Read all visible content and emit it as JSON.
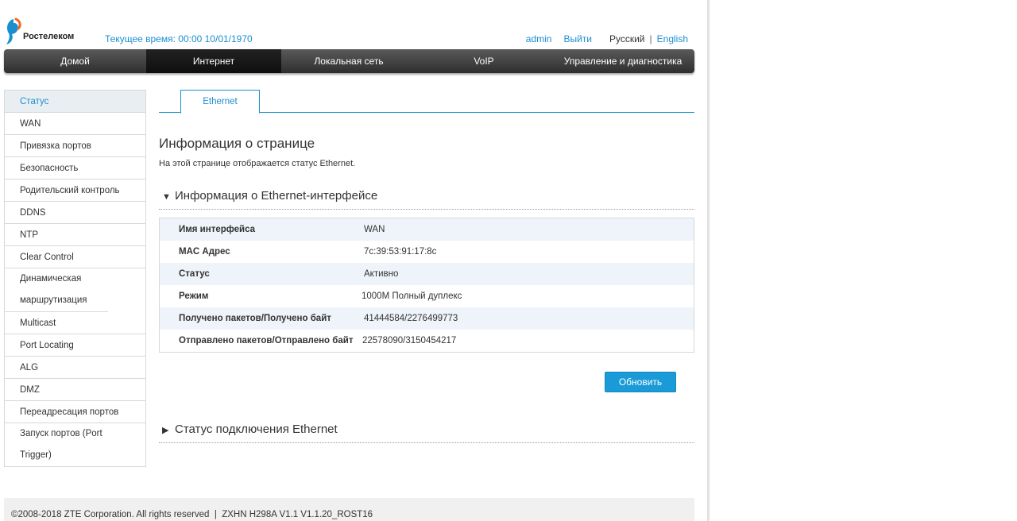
{
  "header": {
    "logo_text": "Ростелеком",
    "current_time": "Текущее время: 00:00 10/01/1970",
    "user": "admin",
    "logout": "Выйти",
    "lang_current": "Русский",
    "lang_sep": "|",
    "lang_other": "English"
  },
  "nav": {
    "items": [
      "Домой",
      "Интернет",
      "Локальная сеть",
      "VoIP",
      "Управление и диагностика"
    ],
    "active_index": 1
  },
  "sidebar": {
    "items": [
      "Статус",
      "WAN",
      "Привязка портов",
      "Безопасность",
      "Родительский контроль",
      "DDNS",
      "NTP",
      "Clear Control",
      "Динамическая маршрутизация",
      "Multicast",
      "Port Locating",
      "ALG",
      "DMZ",
      "Переадресация портов",
      "Запуск портов (Port Trigger)"
    ],
    "active_index": 0
  },
  "tabs": {
    "active": "Ethernet"
  },
  "page": {
    "title": "Информация о странице",
    "description": "На этой странице отображается статус Ethernet."
  },
  "section1": {
    "title": "Информация о Ethernet-интерфейсе",
    "rows": [
      {
        "label": "Имя интерфейса",
        "value": "WAN"
      },
      {
        "label": "MAC Адрес",
        "value": "7c:39:53:91:17:8c"
      },
      {
        "label": "Статус",
        "value": "Активно"
      },
      {
        "label": "Режим",
        "value": "1000M Полный дуплекс"
      },
      {
        "label": "Получено пакетов/Получено байт",
        "value": "41444584/2276499773"
      },
      {
        "label": "Отправлено пакетов/Отправлено байт",
        "value": "22578090/3150454217"
      }
    ]
  },
  "refresh_button": "Обновить",
  "section2": {
    "title": "Статус подключения Ethernet"
  },
  "footer": {
    "text": "©2008-2018 ZTE Corporation. All rights reserved  |  ZXHN H298A V1.1 V1.1.20_ROST16"
  },
  "colors": {
    "accent": "#1a8fcf",
    "button": "#1a9bd7",
    "nav_dark": "#2e2e2e",
    "row_alt": "#eef4fa"
  }
}
